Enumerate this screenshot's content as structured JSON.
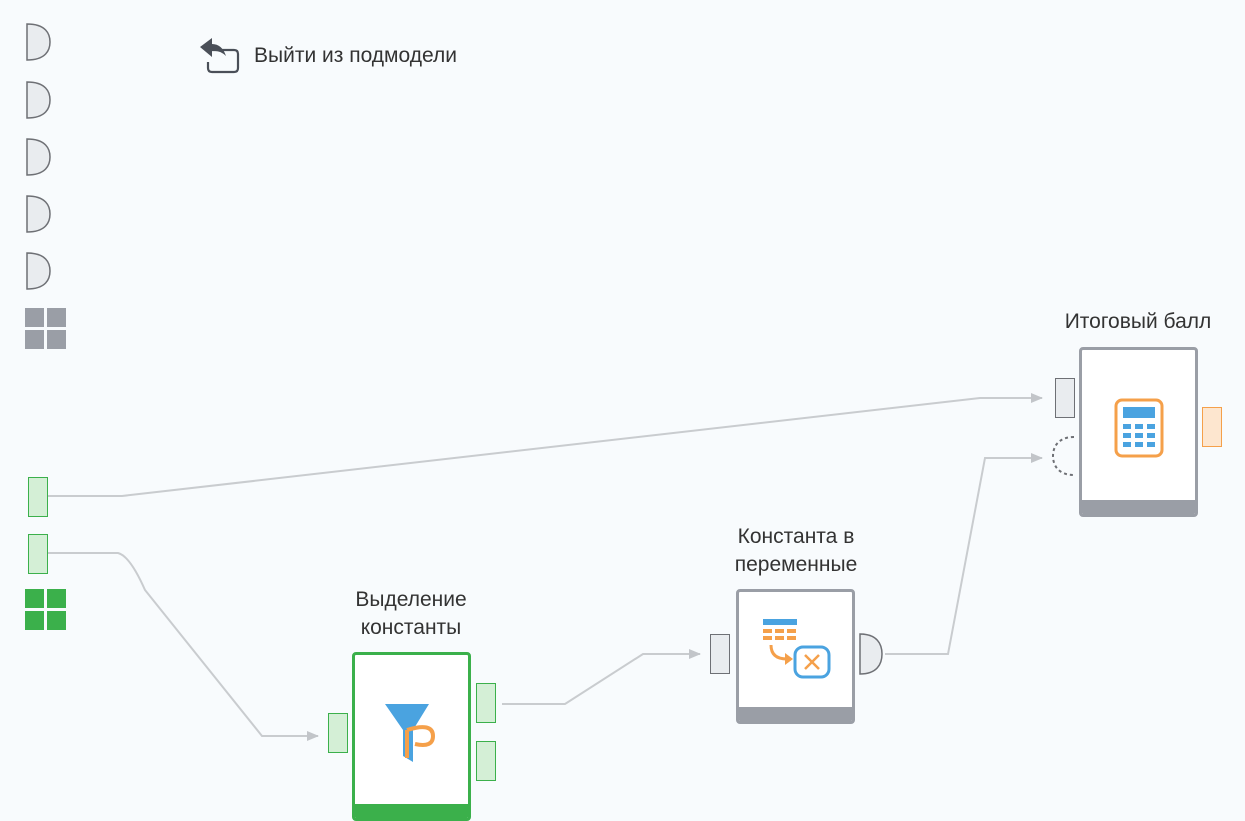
{
  "toolbar": {
    "exit_label": "Выйти из подмодели",
    "exit_icon": "undo-arrow-icon"
  },
  "nodes": {
    "total_score": {
      "title": "Итоговый балл",
      "icon": "calculator-icon"
    },
    "const_to_vars": {
      "title_line1": "Константа в",
      "title_line2": "переменные",
      "icon": "table-to-variable-icon"
    },
    "extract_const": {
      "title_line1": "Выделение",
      "title_line2": "константы",
      "icon": "filter-funnel-icon"
    }
  },
  "left_panel": {
    "variable_ports": [
      "variable-port",
      "variable-port",
      "variable-port",
      "variable-port",
      "variable-port"
    ],
    "input_ports": [
      "table-port",
      "table-port"
    ]
  },
  "colors": {
    "background": "#f8fbfd",
    "selected": "#3bb04b",
    "node_border": "#9a9ea6",
    "link": "#c9cccf",
    "accent_orange": "#f5a04a",
    "accent_blue": "#4aa3e0"
  }
}
